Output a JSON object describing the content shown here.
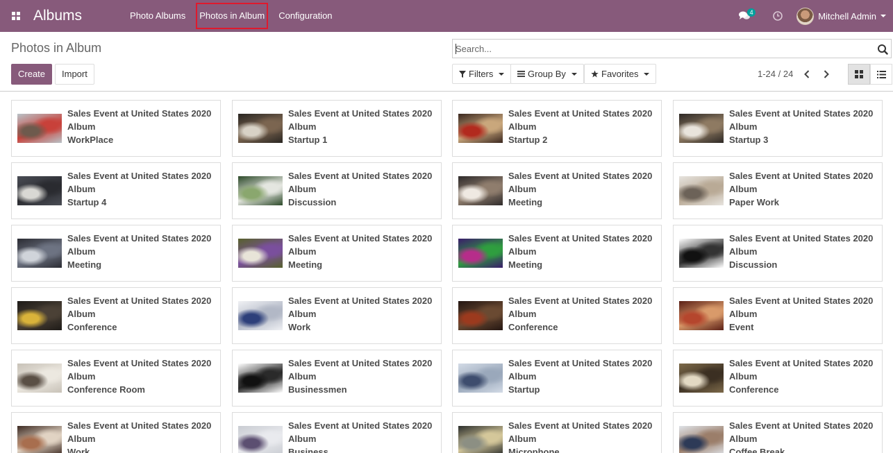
{
  "navbar": {
    "brand": "Albums",
    "menu": [
      "Photo Albums",
      "Photos in Album",
      "Configuration"
    ],
    "chat_count": "4",
    "user_name": "Mitchell Admin"
  },
  "control": {
    "title": "Photos in Album",
    "create_label": "Create",
    "import_label": "Import",
    "search_placeholder": "Search...",
    "filters_label": "Filters",
    "groupby_label": "Group By",
    "favorites_label": "Favorites",
    "pager": "1-24 / 24"
  },
  "colors": {
    "brand": "#875a7b",
    "badge": "#00a09d",
    "highlight": "#e0192d"
  },
  "cards": [
    {
      "event": "Sales Event at United States 2020",
      "type": "Album",
      "name": "WorkPlace",
      "img": [
        "#b9c3c8",
        "#6e5a4d",
        "#c8413a"
      ]
    },
    {
      "event": "Sales Event at United States 2020",
      "type": "Album",
      "name": "Startup 1",
      "img": [
        "#2a2622",
        "#d8d2c6",
        "#7b6550"
      ]
    },
    {
      "event": "Sales Event at United States 2020",
      "type": "Album",
      "name": "Startup 2",
      "img": [
        "#3b2820",
        "#b22a1e",
        "#c9a77c"
      ]
    },
    {
      "event": "Sales Event at United States 2020",
      "type": "Album",
      "name": "Startup 3",
      "img": [
        "#2e2925",
        "#e9e4dc",
        "#8e7a62"
      ]
    },
    {
      "event": "Sales Event at United States 2020",
      "type": "Album",
      "name": "Startup 4",
      "img": [
        "#4a4d55",
        "#d9d8d4",
        "#2a2b30"
      ]
    },
    {
      "event": "Sales Event at United States 2020",
      "type": "Album",
      "name": "Discussion",
      "img": [
        "#2d4a2a",
        "#8aa76e",
        "#e4e6e0"
      ]
    },
    {
      "event": "Sales Event at United States 2020",
      "type": "Album",
      "name": "Meeting",
      "img": [
        "#2f2b2b",
        "#efe9e2",
        "#8f7d6d"
      ]
    },
    {
      "event": "Sales Event at United States 2020",
      "type": "Album",
      "name": "Paper Work",
      "img": [
        "#e7e4df",
        "#6c6258",
        "#b9aa96"
      ]
    },
    {
      "event": "Sales Event at United States 2020",
      "type": "Album",
      "name": "Meeting",
      "img": [
        "#2b2c33",
        "#d0d4da",
        "#6d7382"
      ]
    },
    {
      "event": "Sales Event at United States 2020",
      "type": "Album",
      "name": "Meeting",
      "img": [
        "#57612c",
        "#e8e4d8",
        "#7a4f9d"
      ]
    },
    {
      "event": "Sales Event at United States 2020",
      "type": "Album",
      "name": "Meeting",
      "img": [
        "#3a1c6b",
        "#b62d8a",
        "#2f9e3f"
      ]
    },
    {
      "event": "Sales Event at United States 2020",
      "type": "Album",
      "name": "Discussion",
      "img": [
        "#ffffff",
        "#111111",
        "#333333"
      ]
    },
    {
      "event": "Sales Event at United States 2020",
      "type": "Album",
      "name": "Conference",
      "img": [
        "#1e1b18",
        "#d9b33a",
        "#4b4136"
      ]
    },
    {
      "event": "Sales Event at United States 2020",
      "type": "Album",
      "name": "Work",
      "img": [
        "#f0f1f4",
        "#2d3f7a",
        "#b2b8c6"
      ]
    },
    {
      "event": "Sales Event at United States 2020",
      "type": "Album",
      "name": "Conference",
      "img": [
        "#241612",
        "#9c3a1e",
        "#6a4a32"
      ]
    },
    {
      "event": "Sales Event at United States 2020",
      "type": "Album",
      "name": "Event",
      "img": [
        "#5b2016",
        "#b5462d",
        "#d99a6a"
      ]
    },
    {
      "event": "Sales Event at United States 2020",
      "type": "Album",
      "name": "Conference Room",
      "img": [
        "#c8c2b8",
        "#5a4f45",
        "#ece8e0"
      ]
    },
    {
      "event": "Sales Event at United States 2020",
      "type": "Album",
      "name": "Businessmen",
      "img": [
        "#ffffff",
        "#111111",
        "#2a2a2a"
      ]
    },
    {
      "event": "Sales Event at United States 2020",
      "type": "Album",
      "name": "Startup",
      "img": [
        "#d3dbe6",
        "#3e4d6e",
        "#9aa8bb"
      ]
    },
    {
      "event": "Sales Event at United States 2020",
      "type": "Album",
      "name": "Conference",
      "img": [
        "#7d6a4a",
        "#e3d9c3",
        "#3b2f22"
      ]
    },
    {
      "event": "Sales Event at United States 2020",
      "type": "Album",
      "name": "Work",
      "img": [
        "#3d2a22",
        "#a86e4e",
        "#e1d3c3"
      ]
    },
    {
      "event": "Sales Event at United States 2020",
      "type": "Album",
      "name": "Business",
      "img": [
        "#c9ccd2",
        "#5c4f71",
        "#e9eaee"
      ]
    },
    {
      "event": "Sales Event at United States 2020",
      "type": "Album",
      "name": "Microphone",
      "img": [
        "#2b2e2c",
        "#8c8f83",
        "#d4c79a"
      ]
    },
    {
      "event": "Sales Event at United States 2020",
      "type": "Album",
      "name": "Coffee Break",
      "img": [
        "#dfe3e8",
        "#2d3a57",
        "#9b7e6a"
      ]
    }
  ]
}
